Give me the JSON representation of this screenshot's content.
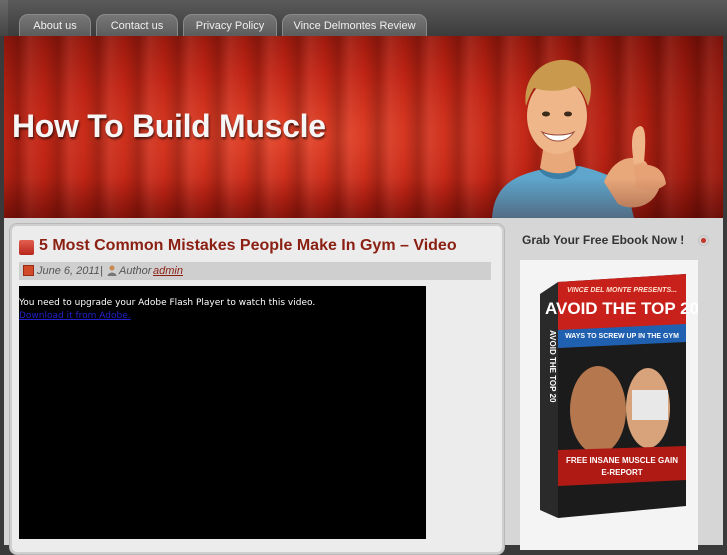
{
  "nav": {
    "tabs": [
      {
        "label": "About us"
      },
      {
        "label": "Contact us"
      },
      {
        "label": "Privacy Policy"
      },
      {
        "label": "Vince Delmontes Review"
      }
    ]
  },
  "header": {
    "site_title": "How To Build Muscle"
  },
  "post": {
    "title": "5 Most Common Mistakes People Make In Gym – Video",
    "date": "June 6, 2011",
    "separator": "|",
    "author_label": "Author",
    "author_name": "admin",
    "video": {
      "message": "You need to upgrade your Adobe Flash Player to watch this video.",
      "link": "Download it from Adobe."
    }
  },
  "sidebar": {
    "heading": "Grab Your Free Ebook Now !",
    "ebook": {
      "top_text": "VINCE DEL MONTE PRESENTS...",
      "title_line1": "AVOID THE TOP 20",
      "title_line2": "WAYS TO SCREW UP IN THE GYM",
      "spine": "AVOID THE TOP 20",
      "subtitle1": "FREE INSANE MUSCLE GAIN",
      "subtitle2": "E-REPORT"
    }
  },
  "colors": {
    "accent": "#8a1f12",
    "header_red": "#c02414"
  }
}
